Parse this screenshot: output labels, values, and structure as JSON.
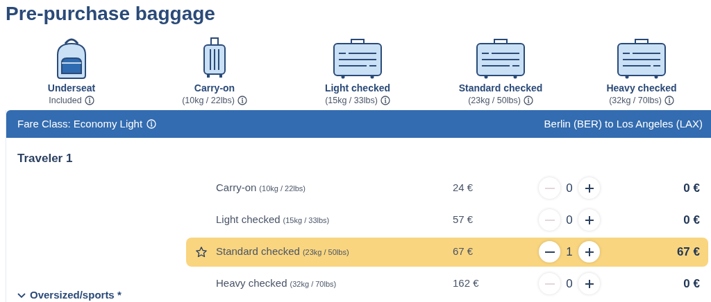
{
  "title": "Pre-purchase baggage",
  "baggage_types": [
    {
      "kind": "backpack",
      "label": "Underseat",
      "detail": "Included"
    },
    {
      "kind": "upright",
      "label": "Carry-on",
      "detail": "(10kg / 22lbs)"
    },
    {
      "kind": "case",
      "label": "Light checked",
      "detail": "(15kg / 33lbs)"
    },
    {
      "kind": "case",
      "label": "Standard checked",
      "detail": "(23kg / 50lbs)"
    },
    {
      "kind": "case",
      "label": "Heavy checked",
      "detail": "(32kg / 70lbs)"
    }
  ],
  "fare_bar": {
    "fare_class": "Fare Class: Economy Light",
    "route": "Berlin (BER) to Los Angeles (LAX)"
  },
  "traveler": "Traveler 1",
  "rows": [
    {
      "name": "Carry-on",
      "weight": "(10kg / 22lbs)",
      "price": "24 €",
      "count": "0",
      "total": "0 €",
      "selected": false
    },
    {
      "name": "Light checked",
      "weight": "(15kg / 33lbs)",
      "price": "57 €",
      "count": "0",
      "total": "0 €",
      "selected": false
    },
    {
      "name": "Standard checked",
      "weight": "(23kg / 50lbs)",
      "price": "67 €",
      "count": "1",
      "total": "67 €",
      "selected": true
    },
    {
      "name": "Heavy checked",
      "weight": "(32kg / 70lbs)",
      "price": "162 €",
      "count": "0",
      "total": "0 €",
      "selected": false
    }
  ],
  "oversized": {
    "label": "Oversized/sports *",
    "expanded": false
  }
}
